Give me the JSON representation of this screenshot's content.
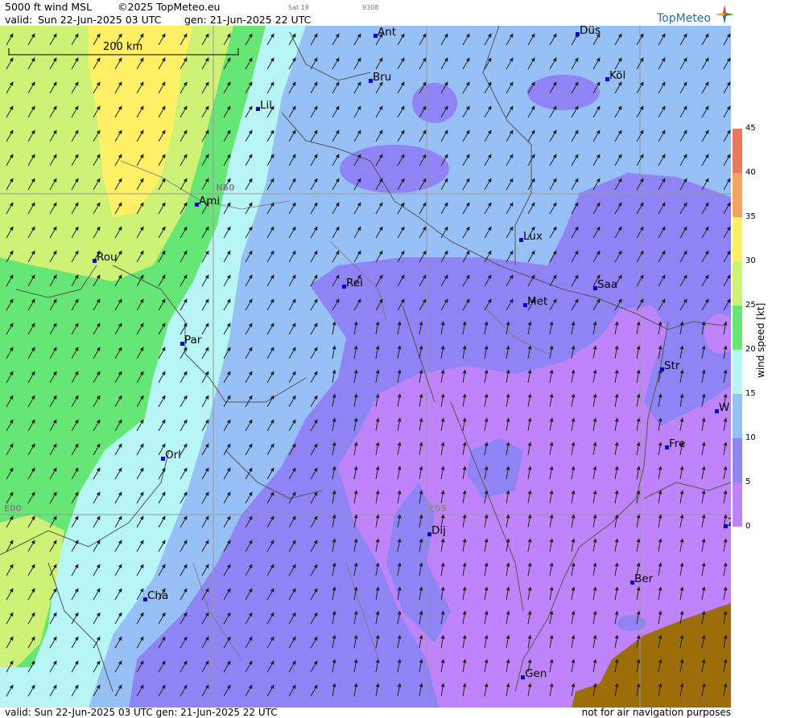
{
  "header": {
    "product": "5000 ft wind MSL",
    "copyright": "©2025 TopMeteo.eu",
    "valid_label": "valid:",
    "valid": "Sun  22-Jun-2025  03 UTC",
    "gen": "gen: 21-Jun-2025 22 UTC",
    "tiny1": "Sat 18",
    "tiny2": "9308",
    "brand": "TopMeteo"
  },
  "scale_bar": {
    "label": "200 km"
  },
  "grid_labels": {
    "lat": "N50",
    "lon1": "E00",
    "lon2": "E05"
  },
  "cities": [
    {
      "name": "Ant"
    },
    {
      "name": "Düs"
    },
    {
      "name": "Bru"
    },
    {
      "name": "Köl"
    },
    {
      "name": "Lil"
    },
    {
      "name": "Ami"
    },
    {
      "name": "Lux"
    },
    {
      "name": "Rou"
    },
    {
      "name": "Rei"
    },
    {
      "name": "Saa"
    },
    {
      "name": "Met"
    },
    {
      "name": "Par"
    },
    {
      "name": "Str"
    },
    {
      "name": "W"
    },
    {
      "name": "Fre"
    },
    {
      "name": "Orl"
    },
    {
      "name": "Dij"
    },
    {
      "name": "Ber"
    },
    {
      "name": "Cha"
    },
    {
      "name": "Gen"
    },
    {
      "name": "Z"
    }
  ],
  "legend": {
    "title": "wind  speed  [kt]",
    "ticks": [
      "45",
      "40",
      "35",
      "30",
      "25",
      "20",
      "15",
      "10",
      "5",
      "0"
    ],
    "colors": [
      "#e87860",
      "#f4a460",
      "#fff066",
      "#cdf275",
      "#66e675",
      "#b6f6f6",
      "#96c0f6",
      "#8e84f6",
      "#c084fa",
      "#ffffff"
    ]
  },
  "footer": {
    "valid": "valid:  Sun  22-Jun-2025  03 UTC    gen: 21-Jun-2025 22 UTC",
    "disclaimer": "not for air navigation purposes"
  }
}
